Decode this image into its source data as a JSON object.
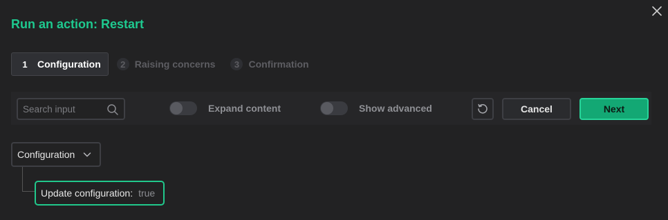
{
  "dialog": {
    "title": "Run an action: Restart"
  },
  "steps": [
    {
      "number": "1",
      "label": "Configuration",
      "state": "active"
    },
    {
      "number": "2",
      "label": "Raising concerns",
      "state": "inactive"
    },
    {
      "number": "3",
      "label": "Confirmation",
      "state": "inactive"
    }
  ],
  "toolbar": {
    "search_placeholder": "Search input",
    "expand_label": "Expand content",
    "expand_on": false,
    "advanced_label": "Show advanced",
    "advanced_on": false,
    "reset_icon": "reset-icon",
    "cancel_label": "Cancel",
    "next_label": "Next"
  },
  "tree": {
    "group_label": "Configuration",
    "node_key": "Update configuration:",
    "node_value": "true"
  },
  "colors": {
    "accent": "#1ec98f",
    "primary_button": "#13a874",
    "background": "#222223"
  }
}
